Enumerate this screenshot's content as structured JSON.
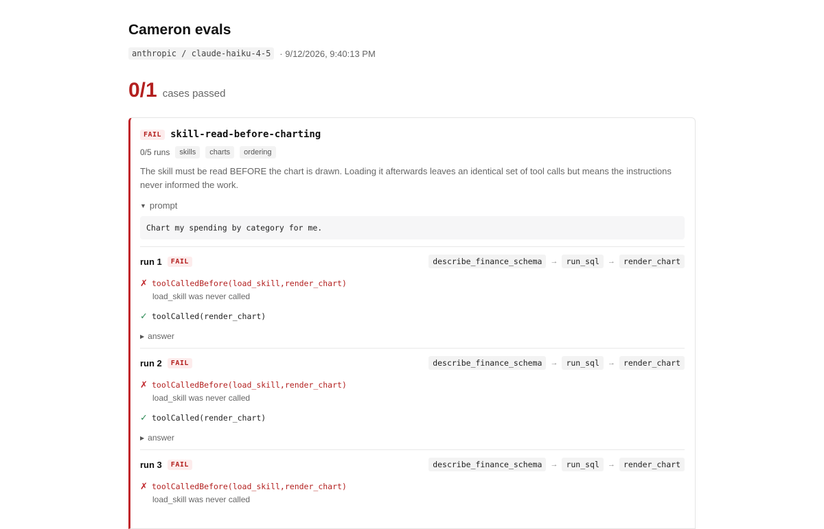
{
  "header": {
    "title": "Cameron evals",
    "model": "anthropic / claude-haiku-4-5",
    "timestamp": "· 9/12/2026, 9:40:13 PM"
  },
  "summary": {
    "score": "0/1",
    "label": "cases passed"
  },
  "case": {
    "status": "FAIL",
    "name": "skill-read-before-charting",
    "runs_text": "0/5 runs",
    "tags": [
      "skills",
      "charts",
      "ordering"
    ],
    "description": "The skill must be read BEFORE the chart is drawn. Loading it afterwards leaves an identical set of tool calls but means the instructions never informed the work.",
    "prompt_toggle": "prompt",
    "prompt": "Chart my spending by category for me.",
    "runs": [
      {
        "label": "run 1",
        "status": "FAIL",
        "trace": [
          "describe_finance_schema",
          "run_sql",
          "render_chart"
        ],
        "checks": [
          {
            "result": "fail",
            "mark": "✗",
            "text": "toolCalledBefore(load_skill,render_chart)",
            "detail": "load_skill was never called"
          },
          {
            "result": "pass",
            "mark": "✓",
            "text": "toolCalled(render_chart)",
            "detail": ""
          }
        ],
        "answer_toggle": "answer"
      },
      {
        "label": "run 2",
        "status": "FAIL",
        "trace": [
          "describe_finance_schema",
          "run_sql",
          "render_chart"
        ],
        "checks": [
          {
            "result": "fail",
            "mark": "✗",
            "text": "toolCalledBefore(load_skill,render_chart)",
            "detail": "load_skill was never called"
          },
          {
            "result": "pass",
            "mark": "✓",
            "text": "toolCalled(render_chart)",
            "detail": ""
          }
        ],
        "answer_toggle": "answer"
      },
      {
        "label": "run 3",
        "status": "FAIL",
        "trace": [
          "describe_finance_schema",
          "run_sql",
          "render_chart"
        ],
        "checks": [
          {
            "result": "fail",
            "mark": "✗",
            "text": "toolCalledBefore(load_skill,render_chart)",
            "detail": "load_skill was never called"
          }
        ],
        "answer_toggle": ""
      }
    ]
  },
  "icons": {
    "caret_down": "caret-down-icon",
    "caret_right": "caret-right-icon",
    "arrow": "arrow-right-icon"
  },
  "colors": {
    "fail": "#b3201f",
    "pass": "#2e8b57",
    "accent_border": "#c0252a"
  }
}
